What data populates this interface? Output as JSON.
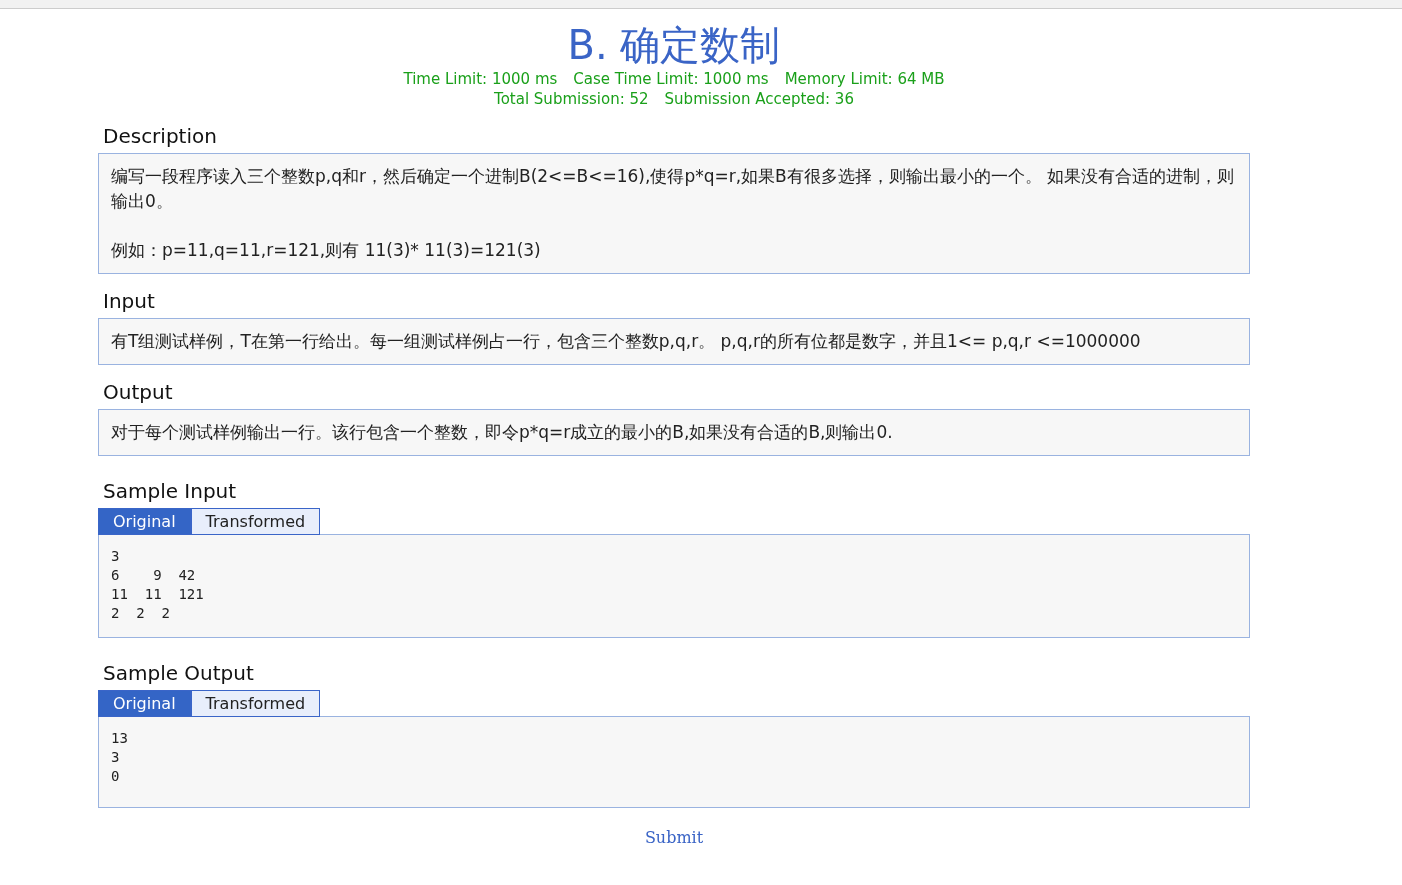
{
  "problem": {
    "title": "B. 确定数制",
    "limits": [
      "Time Limit: 1000 ms",
      "Case Time Limit: 1000 ms",
      "Memory Limit: 64 MB"
    ],
    "stats": [
      "Total Submission: 52",
      "Submission Accepted: 36"
    ]
  },
  "sections": [
    {
      "kind": "text",
      "heading": "Description",
      "paragraphs": [
        "编写一段程序读入三个整数p,q和r，然后确定一个进制B(2<=B<=16),使得p*q=r,如果B有很多选择，则输出最小的一个。 如果没有合适的进制，则输出0。",
        "例如：p=11,q=11,r=121,则有 11(3)* 11(3)=121(3)"
      ]
    },
    {
      "kind": "text",
      "heading": "Input",
      "paragraphs": [
        "有T组测试样例，T在第一行给出。每一组测试样例占一行，包含三个整数p,q,r。 p,q,r的所有位都是数字，并且1<= p,q,r <=1000000"
      ]
    },
    {
      "kind": "text",
      "heading": "Output",
      "paragraphs": [
        "对于每个测试样例输出一行。该行包含一个整数，即令p*q=r成立的最小的B,如果没有合适的B,则输出0."
      ]
    },
    {
      "kind": "sample",
      "heading": "Sample Input",
      "tabs": [
        {
          "label": "Original",
          "selected": true
        },
        {
          "label": "Transformed",
          "selected": false
        }
      ],
      "lines": [
        "3",
        "6    9  42",
        "11  11  121",
        "2  2  2"
      ]
    },
    {
      "kind": "sample",
      "heading": "Sample Output",
      "tabs": [
        {
          "label": "Original",
          "selected": true
        },
        {
          "label": "Transformed",
          "selected": false
        }
      ],
      "lines": [
        "13",
        "3",
        "0"
      ]
    }
  ],
  "submit": {
    "label": "Submit"
  }
}
